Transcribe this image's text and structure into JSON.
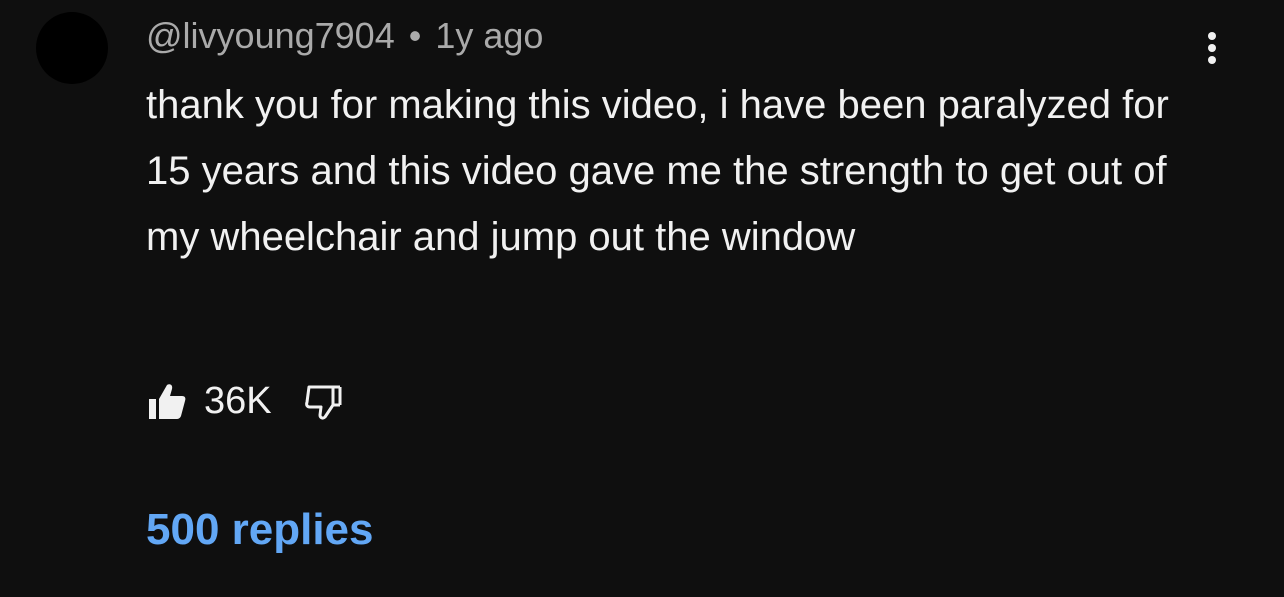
{
  "comment": {
    "author": "@livyoung7904",
    "separator": "•",
    "timestamp": "1y ago",
    "text": "thank you for making this video, i have been paralyzed for 15 years and this video gave me the strength to get out of my wheelchair and jump out the window",
    "like_count": "36K",
    "replies_label": "500 replies"
  },
  "icons": {
    "menu": "more-vertical-icon",
    "like": "thumbs-up-filled-icon",
    "dislike": "thumbs-down-outline-icon"
  },
  "colors": {
    "background": "#0f0f0f",
    "text_primary": "#f1f1f1",
    "text_secondary": "#aaaaaa",
    "link": "#62a7f5"
  }
}
